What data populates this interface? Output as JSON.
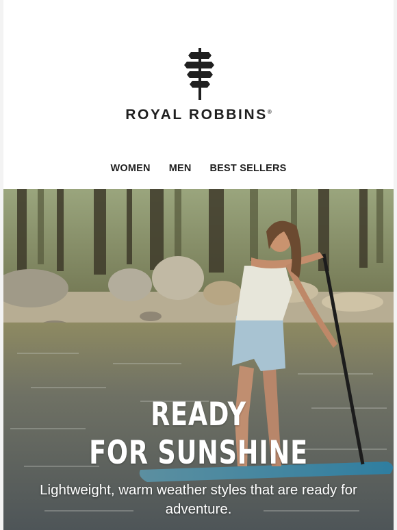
{
  "brand": {
    "name": "ROYAL ROBBINS",
    "trademark": "®",
    "logo_icon": "tree-signpost-icon"
  },
  "nav": [
    {
      "label": "WOMEN"
    },
    {
      "label": "MEN"
    },
    {
      "label": "BEST SELLERS"
    }
  ],
  "hero": {
    "headline_line1": "READY",
    "headline_line2": "FOR SUNSHINE",
    "subtext": "Lightweight, warm weather styles that are ready for adventure.",
    "image": "woman-paddleboarding-on-lake-photo"
  },
  "colors": {
    "text": "#1f1f1f",
    "background": "#ffffff",
    "hero_text": "#ffffff"
  }
}
